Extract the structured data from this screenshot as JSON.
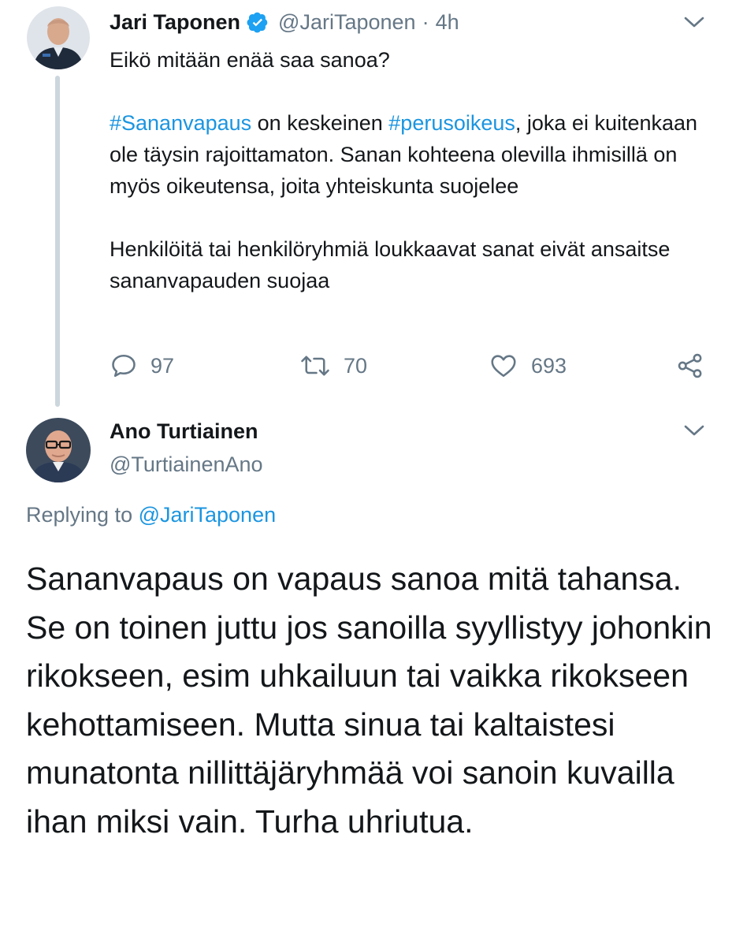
{
  "tweet1": {
    "name": "Jari Taponen",
    "handle": "@JariTaponen",
    "separator": "·",
    "time": "4h",
    "avatar_icon": "profile-photo-uniformed-man",
    "verified_icon": "verified-badge-icon",
    "body": {
      "line1": "Eikö mitään enää saa sanoa?",
      "hashtag1": "#Sananvapaus",
      "text_a": " on keskeinen ",
      "hashtag2": "#perusoikeus",
      "text_b": ", joka ei kuitenkaan ole täysin rajoittamaton. Sanan kohteena olevilla ihmisillä on myös oikeutensa, joita yhteiskunta suojelee",
      "paragraph3": "Henkilöitä tai henkilöryhmiä loukkaavat sanat eivät ansaitse sananvapauden suojaa"
    },
    "actions": {
      "replies": "97",
      "retweets": "70",
      "likes": "693"
    }
  },
  "tweet2": {
    "name": "Ano Turtiainen",
    "handle": "@TurtiainenAno",
    "avatar_icon": "profile-photo-man-glasses",
    "replying_prefix": "Replying to ",
    "replying_to": "@JariTaponen",
    "body": "Sananvapaus on vapaus sanoa mitä tahansa. Se on toinen juttu jos sanoilla syyllistyy johonkin rikokseen, esim uhkailuun tai vaikka rikokseen kehottamiseen. Mutta sinua tai kaltaistesi munatonta nillittäjäryhmää voi sanoin kuvailla ihan miksi vain. Turha uhriutua."
  },
  "colors": {
    "link": "#1b95e0",
    "secondary_text": "#657786",
    "primary_text": "#14171a",
    "thread_line": "#ccd6dd"
  }
}
